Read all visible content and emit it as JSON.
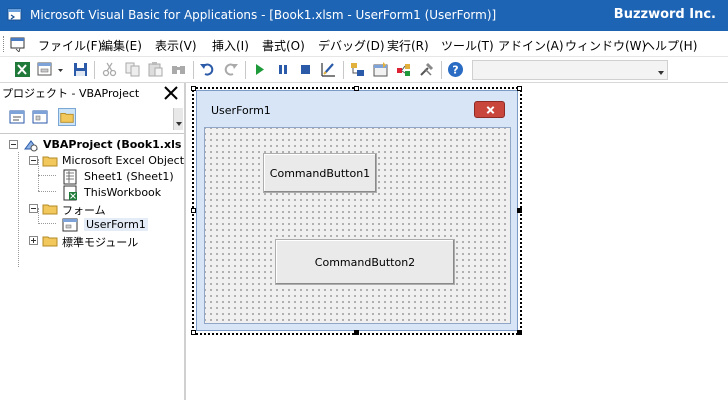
{
  "window": {
    "title": "Microsoft Visual Basic for Applications - [Book1.xlsm - UserForm1 (UserForm)]",
    "account": "Buzzword Inc."
  },
  "menu": {
    "items": [
      "ファイル(F)",
      "編集(E)",
      "表示(V)",
      "挿入(I)",
      "書式(O)",
      "デバッグ(D)",
      "実行(R)",
      "ツール(T)",
      "アドイン(A)",
      "ウィンドウ(W)",
      "ヘルプ(H)"
    ]
  },
  "toolbar": {
    "icons": [
      "excel-view-icon",
      "insert-userform-icon",
      "save-icon",
      "cut-icon",
      "copy-icon",
      "paste-icon",
      "find-icon",
      "undo-icon",
      "redo-icon",
      "run-icon",
      "break-icon",
      "reset-icon",
      "design-mode-icon",
      "project-explorer-icon",
      "properties-icon",
      "object-browser-icon",
      "toolbox-icon",
      "help-icon"
    ],
    "field_value": ""
  },
  "project": {
    "title": "プロジェクト - VBAProject",
    "tree": [
      {
        "label": "VBAProject (Book1.xls",
        "level": 0,
        "expander": "minus",
        "icon": "vbaproject-icon",
        "bold": true
      },
      {
        "label": "Microsoft Excel Object",
        "level": 1,
        "expander": "minus",
        "icon": "folder-icon"
      },
      {
        "label": "Sheet1 (Sheet1)",
        "level": 2,
        "expander": "",
        "icon": "sheet-icon"
      },
      {
        "label": "ThisWorkbook",
        "level": 2,
        "expander": "",
        "icon": "workbook-icon"
      },
      {
        "label": "フォーム",
        "level": 1,
        "expander": "minus",
        "icon": "folder-icon"
      },
      {
        "label": "UserForm1",
        "level": 2,
        "expander": "",
        "icon": "userform-icon",
        "selected": true
      },
      {
        "label": "標準モジュール",
        "level": 1,
        "expander": "plus",
        "icon": "folder-icon"
      }
    ]
  },
  "form": {
    "caption": "UserForm1",
    "buttons": [
      {
        "label": "CommandButton1"
      },
      {
        "label": "CommandButton2"
      }
    ]
  },
  "colors": {
    "titlebar": "#1e64b4",
    "form_frame": "#d7e5f7",
    "close_button": "#c9463d"
  }
}
